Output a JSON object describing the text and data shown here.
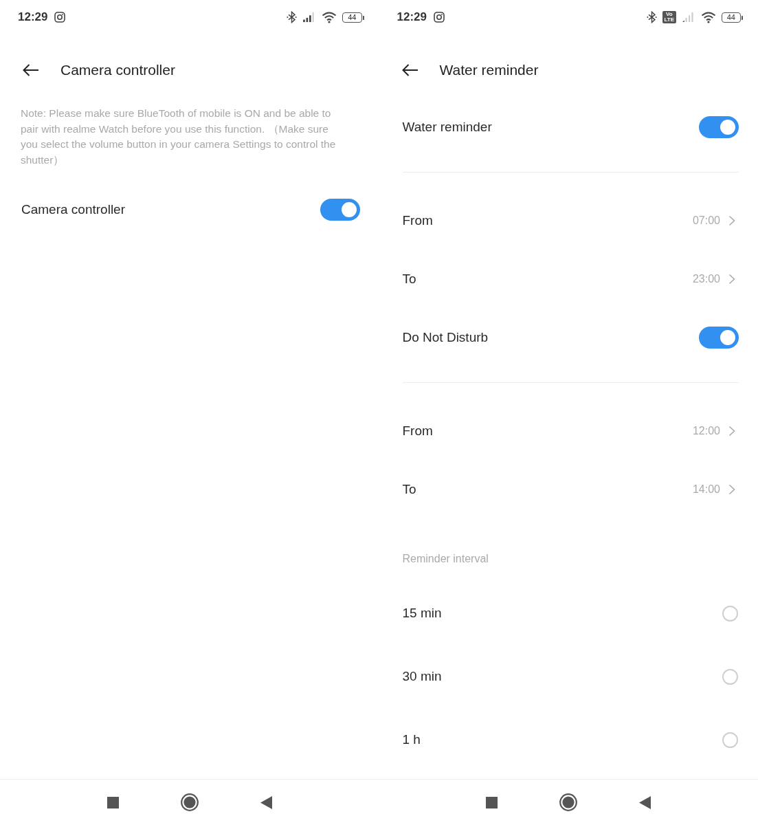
{
  "screens": [
    {
      "status_bar": {
        "time": "12:29",
        "notification_icons": [
          {
            "kind": "camera"
          }
        ],
        "system_icons": [
          {
            "kind": "bluetooth"
          },
          {
            "kind": "signal"
          },
          {
            "kind": "wifi"
          }
        ],
        "battery": "44"
      },
      "title": "Camera controller",
      "note": "Note: Please make sure BlueTooth of mobile is ON and be able to pair with realme Watch before you use this function. （Make sure you select the volume button in your camera Settings to control the shutter）",
      "sections": [
        {
          "divider": false,
          "items": [
            {
              "kind": "toggle",
              "label": "Camera controller",
              "on": true
            }
          ]
        }
      ],
      "nav_bar": [
        {
          "kind": "recents"
        },
        {
          "kind": "home"
        },
        {
          "kind": "back"
        }
      ]
    },
    {
      "status_bar": {
        "time": "12:29",
        "notification_icons": [
          {
            "kind": "camera"
          }
        ],
        "system_icons": [
          {
            "kind": "bluetooth"
          },
          {
            "kind": "volte",
            "label": "Vo LTE"
          },
          {
            "kind": "weaksignal"
          },
          {
            "kind": "wifi"
          }
        ],
        "battery": "44"
      },
      "title": "Water reminder",
      "sections": [
        {
          "divider": true,
          "items": [
            {
              "kind": "toggle",
              "label": "Water reminder",
              "on": true
            }
          ]
        },
        {
          "divider": true,
          "items": [
            {
              "kind": "time",
              "label": "From",
              "value": "07:00"
            },
            {
              "kind": "time",
              "label": "To",
              "value": "23:00"
            },
            {
              "kind": "toggle",
              "label": "Do Not Disturb",
              "on": true
            }
          ]
        },
        {
          "divider": false,
          "items": [
            {
              "kind": "time",
              "label": "From",
              "value": "12:00"
            },
            {
              "kind": "time",
              "label": "To",
              "value": "14:00"
            }
          ]
        },
        {
          "divider": false,
          "header": "Reminder interval",
          "items": [
            {
              "kind": "radio",
              "label": "15 min",
              "selected": false
            },
            {
              "kind": "radio",
              "label": "30 min",
              "selected": false
            },
            {
              "kind": "radio",
              "label": "1 h",
              "selected": false
            }
          ]
        }
      ],
      "nav_bar": [
        {
          "kind": "recents"
        },
        {
          "kind": "home"
        },
        {
          "kind": "back"
        }
      ]
    }
  ]
}
